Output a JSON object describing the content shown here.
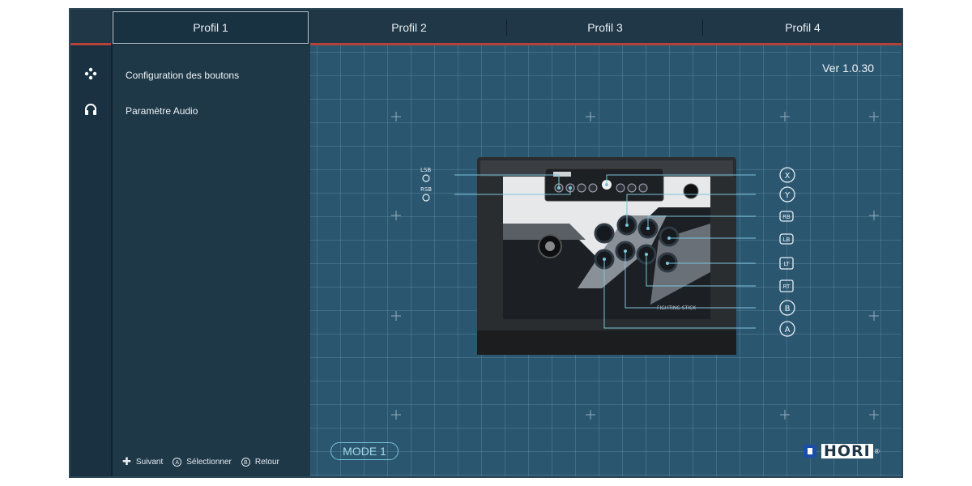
{
  "tabs": [
    {
      "label": "Profil 1",
      "active": true
    },
    {
      "label": "Profil 2",
      "active": false
    },
    {
      "label": "Profil 3",
      "active": false
    },
    {
      "label": "Profil 4",
      "active": false
    }
  ],
  "rail": {
    "icons": [
      "gamepad-icon",
      "headphones-icon"
    ]
  },
  "menu": {
    "items": [
      {
        "label": "Configuration des boutons"
      },
      {
        "label": "Paramètre Audio"
      }
    ]
  },
  "hints": {
    "next_symbol": "✚",
    "next": "Suivant",
    "select_symbol": "A",
    "select": "Sélectionner",
    "back_symbol": "B",
    "back": "Retour"
  },
  "version": "Ver 1.0.30",
  "mode": "MODE 1",
  "logo": {
    "text": "HORI",
    "reg": "®"
  },
  "left_labels": [
    "LSB",
    "RSB"
  ],
  "right_labels": [
    "X",
    "Y",
    "RB",
    "LB",
    "LT",
    "RT",
    "B",
    "A"
  ],
  "device_text": {
    "brand": "FIGHTING STICK"
  },
  "colors": {
    "accent_red": "#b5433a",
    "grid_bg": "#2b5670",
    "line": "#7cc4dc"
  }
}
